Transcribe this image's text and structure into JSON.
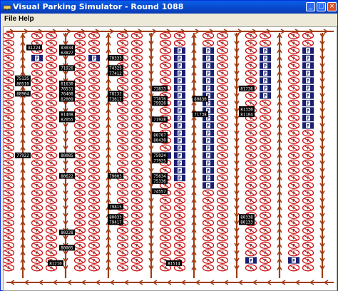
{
  "window": {
    "title": "Visual Parking Simulator - Round 1088",
    "min_symbol": "_",
    "max_symbol": "□",
    "close_symbol": "×"
  },
  "menu": [
    {
      "label": "File"
    },
    {
      "label": "Help"
    }
  ],
  "colors": {
    "road": "#a03c14",
    "no_parking_ring": "#cc1111",
    "parking": "#1a2070",
    "car": "#000000",
    "car_text": "#ffffff"
  },
  "icons": {
    "app": "car-app-icon",
    "no_parking": "no-parking-sign-icon",
    "parking": "parking-sign-icon",
    "road_arrow": "road-arrow-icon"
  },
  "parking_sign_letter": "P",
  "cars": [
    {
      "id": "81224"
    },
    {
      "id": "83034"
    },
    {
      "id": "63827"
    },
    {
      "id": "71926"
    },
    {
      "id": "70333"
    },
    {
      "id": "74325"
    },
    {
      "id": "77412"
    },
    {
      "id": "75135"
    },
    {
      "id": "80510"
    },
    {
      "id": "81630"
    },
    {
      "id": "76531"
    },
    {
      "id": "76408"
    },
    {
      "id": "82009"
    },
    {
      "id": "88904"
    },
    {
      "id": "73833"
    },
    {
      "id": "78232"
    },
    {
      "id": "77876"
    },
    {
      "id": "80830"
    },
    {
      "id": "81736"
    },
    {
      "id": "73617"
    },
    {
      "id": "79926"
    },
    {
      "id": "81408"
    },
    {
      "id": "82055"
    },
    {
      "id": "71738"
    },
    {
      "id": "71928"
    },
    {
      "id": "81330"
    },
    {
      "id": "81104"
    },
    {
      "id": "80707"
    },
    {
      "id": "80430"
    },
    {
      "id": "77922"
    },
    {
      "id": "80085"
    },
    {
      "id": "75924"
    },
    {
      "id": "77925"
    },
    {
      "id": "75634"
    },
    {
      "id": "80622"
    },
    {
      "id": "79003"
    },
    {
      "id": "75336"
    },
    {
      "id": "74557"
    },
    {
      "id": "79815"
    },
    {
      "id": "80033"
    },
    {
      "id": "79417"
    },
    {
      "id": "80338"
    },
    {
      "id": "80133"
    },
    {
      "id": "80228"
    },
    {
      "id": "80005"
    },
    {
      "id": "81210"
    },
    {
      "id": "81514"
    }
  ]
}
